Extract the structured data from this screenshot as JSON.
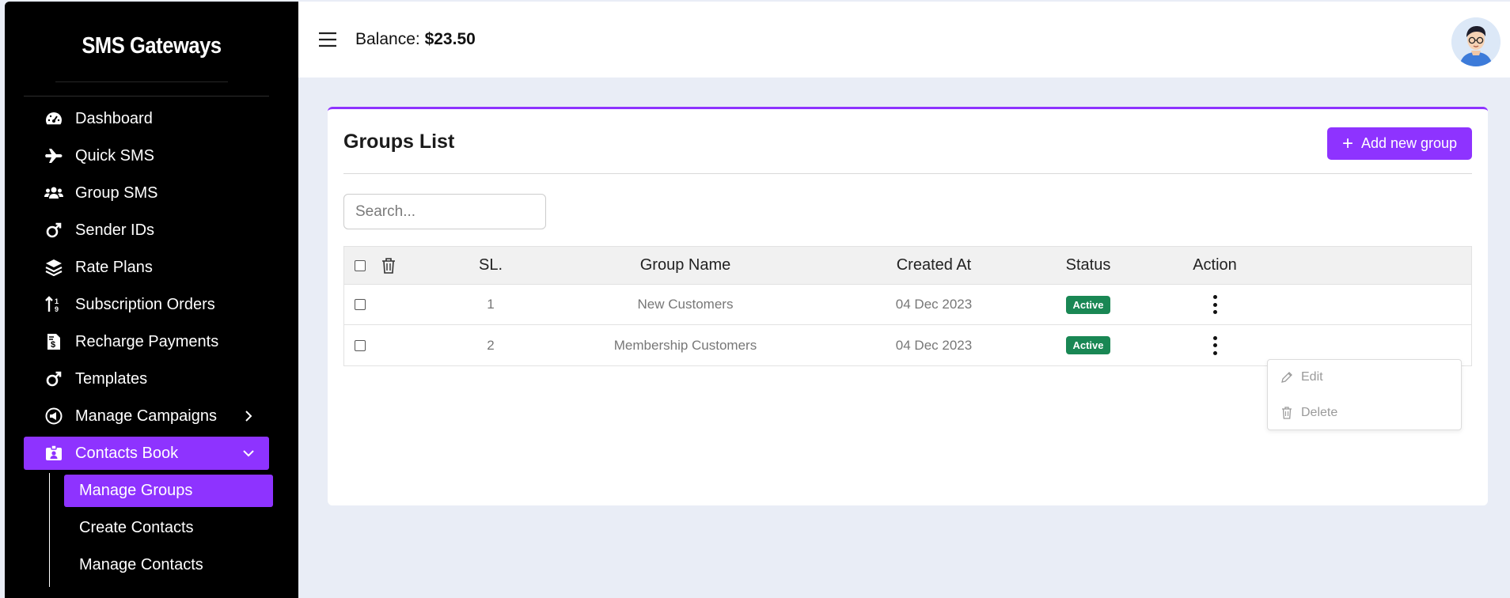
{
  "brand": "SMS Gateways",
  "topbar": {
    "balance_label": "Balance:",
    "balance_value": "$23.50"
  },
  "nav": [
    {
      "label": "Dashboard",
      "icon": "dashboard-icon"
    },
    {
      "label": "Quick SMS",
      "icon": "plane-icon"
    },
    {
      "label": "Group SMS",
      "icon": "users-icon"
    },
    {
      "label": "Sender IDs",
      "icon": "mars-icon"
    },
    {
      "label": "Rate Plans",
      "icon": "layers-icon"
    },
    {
      "label": "Subscription Orders",
      "icon": "sort-icon"
    },
    {
      "label": "Recharge Payments",
      "icon": "invoice-icon"
    },
    {
      "label": "Templates",
      "icon": "mars-icon"
    },
    {
      "label": "Manage Campaigns",
      "icon": "bullhorn-icon",
      "expanded": false
    },
    {
      "label": "Contacts Book",
      "icon": "id-card-icon",
      "expanded": true,
      "active": true
    }
  ],
  "sub_nav": [
    {
      "label": "Manage Groups",
      "active": true
    },
    {
      "label": "Create Contacts"
    },
    {
      "label": "Manage Contacts"
    }
  ],
  "card": {
    "title": "Groups List",
    "add_button": "Add new group",
    "search_placeholder": "Search..."
  },
  "table": {
    "headers": {
      "sl": "SL.",
      "name": "Group Name",
      "created": "Created At",
      "status": "Status",
      "action": "Action"
    },
    "rows": [
      {
        "sl": "1",
        "name": "New Customers",
        "created": "04 Dec 2023",
        "status": "Active"
      },
      {
        "sl": "2",
        "name": "Membership Customers",
        "created": "04 Dec 2023",
        "status": "Active"
      }
    ]
  },
  "action_menu": {
    "edit": "Edit",
    "delete": "Delete"
  },
  "colors": {
    "accent": "#8e33ff",
    "sidebar_bg": "#000000",
    "page_bg": "#e9edf6",
    "status_active": "#198754"
  }
}
